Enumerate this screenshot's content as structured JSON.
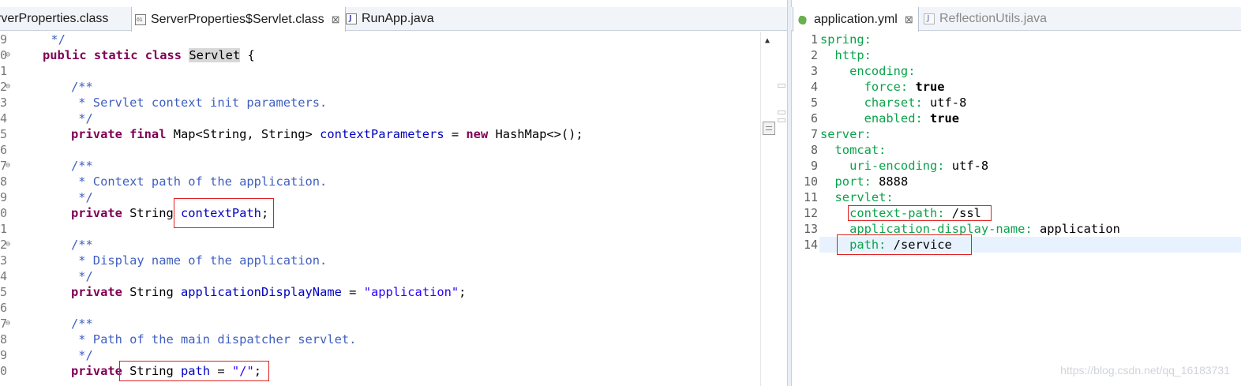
{
  "left_editor": {
    "tabs": [
      {
        "label": "rverProperties.class",
        "icon": "class-file-icon",
        "active": false
      },
      {
        "label": "ServerProperties$Servlet.class",
        "icon": "class-file-icon",
        "active": true,
        "close": "⊠"
      },
      {
        "label": "RunApp.java",
        "icon": "java-file-icon",
        "active": false
      }
    ],
    "line_numbers": [
      "9",
      "0",
      "1",
      "2",
      "3",
      "4",
      "5",
      "6",
      "7",
      "8",
      "9",
      "0",
      "1",
      "2",
      "3",
      "4",
      "5",
      "6",
      "7",
      "8",
      "9",
      "0"
    ],
    "code": {
      "l1_comment_end": "     */",
      "l2_kw": "public static class",
      "l2_name": "Servlet",
      "l2_brace": " {",
      "c1_open": "/**",
      "c1_text": " * Servlet context init parameters.",
      "c1_close": " */",
      "l6_kw": "private final",
      "l6_type": " Map<String, String> ",
      "l6_field": "contextParameters",
      "l6_eq": " = ",
      "l6_new": "new",
      "l6_rest": " HashMap<>();",
      "c2_open": "/**",
      "c2_text": " * Context path of the application.",
      "c2_close": " */",
      "l11_kw": "private",
      "l11_type": " String ",
      "l11_field": "contextPath",
      "l11_semi": ";",
      "c3_open": "/**",
      "c3_text": " * Display name of the application.",
      "c3_close": " */",
      "l16_kw": "private",
      "l16_type": " String ",
      "l16_field": "applicationDisplayName",
      "l16_eq": " = ",
      "l16_str": "\"application\"",
      "l16_semi": ";",
      "c4_open": "/**",
      "c4_text": " * Path of the main dispatcher servlet.",
      "c4_close": " */",
      "l21_kw": "private",
      "l21_type": " String ",
      "l21_field": "path",
      "l21_eq": " = ",
      "l21_str": "\"/\"",
      "l21_semi": ";"
    }
  },
  "right_editor": {
    "tabs": [
      {
        "label": "application.yml",
        "icon": "yaml-file-icon",
        "active": true,
        "close": "⊠"
      },
      {
        "label": "ReflectionUtils.java",
        "icon": "java-file-icon",
        "active": false
      }
    ],
    "lines": [
      {
        "n": "1",
        "key": "spring:",
        "val": ""
      },
      {
        "n": "2",
        "key": "  http:",
        "val": ""
      },
      {
        "n": "3",
        "key": "    encoding:",
        "val": ""
      },
      {
        "n": "4",
        "key": "      force:",
        "val": " true"
      },
      {
        "n": "5",
        "key": "      charset:",
        "val": " utf-8"
      },
      {
        "n": "6",
        "key": "      enabled:",
        "val": " true"
      },
      {
        "n": "7",
        "key": "server:",
        "val": ""
      },
      {
        "n": "8",
        "key": "  tomcat:",
        "val": ""
      },
      {
        "n": "9",
        "key": "    uri-encoding:",
        "val": " utf-8"
      },
      {
        "n": "10",
        "key": "  port:",
        "val": " 8888"
      },
      {
        "n": "11",
        "key": "  servlet:",
        "val": ""
      },
      {
        "n": "12",
        "key": "    context-path:",
        "val": " /ssl"
      },
      {
        "n": "13",
        "key": "    application-display-name:",
        "val": " application"
      },
      {
        "n": "14",
        "key": "    path:",
        "val": " /service"
      }
    ]
  },
  "watermark": "https://blog.csdn.net/qq_16183731",
  "colors": {
    "keyword": "#7f0055",
    "comment": "#3f5fbf",
    "field": "#0000c0",
    "string": "#2a00ff",
    "yaml_key": "#0aa34b",
    "highlight_box": "#e02020"
  }
}
